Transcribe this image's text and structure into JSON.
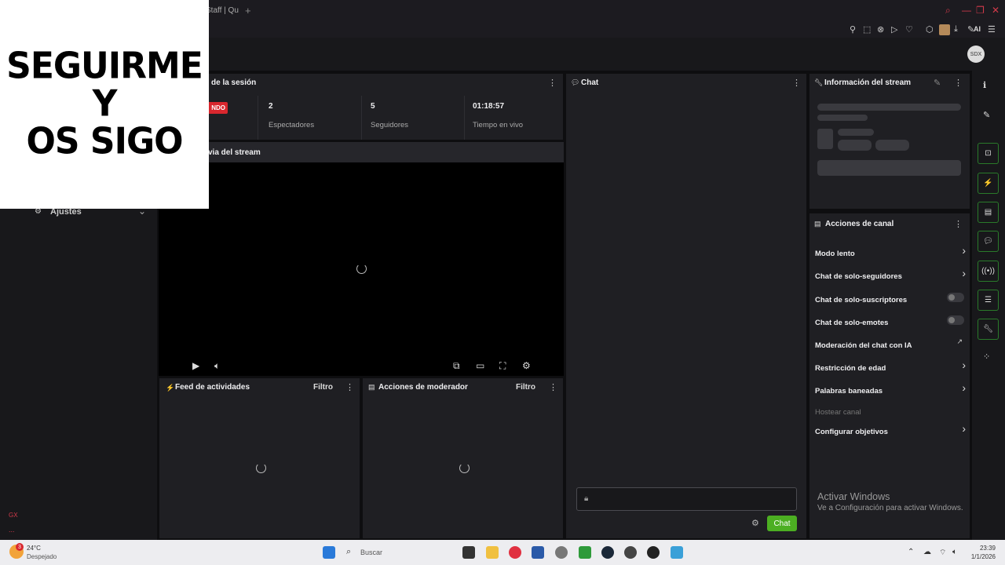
{
  "browser": {
    "tab_title": "Staff | Qu",
    "new_tab": "+",
    "toolbar_ai": "AI"
  },
  "header": {
    "avatar_text": "SDX"
  },
  "overlay": {
    "line1": "SEGUIRME",
    "line2": "Y",
    "line3": "OS SIGO"
  },
  "left_nav": {
    "settings_label": "Ajustes",
    "gx_label": "GX",
    "dots": "..."
  },
  "session": {
    "title": "ón de la sesión",
    "live_badge": "NDO",
    "stats": [
      {
        "value": "2",
        "label": "Espectadores"
      },
      {
        "value": "5",
        "label": "Seguidores"
      },
      {
        "value": "01:18:57",
        "label": "Tiempo en vivo"
      }
    ]
  },
  "preview": {
    "title": "via del stream"
  },
  "feed": {
    "title": "Feed de actividades",
    "filter": "Filtro"
  },
  "moderator": {
    "title": "Acciones de moderador",
    "filter": "Filtro"
  },
  "chat": {
    "title": "Chat",
    "send_label": "Chat"
  },
  "stream_info": {
    "title": "Información del stream"
  },
  "channel_actions": {
    "title": "Acciones de canal",
    "items": [
      {
        "label": "Modo lento",
        "control": "chevron"
      },
      {
        "label": "Chat de solo-seguidores",
        "control": "chevron"
      },
      {
        "label": "Chat de solo-suscriptores",
        "control": "toggle"
      },
      {
        "label": "Chat de solo-emotes",
        "control": "toggle"
      },
      {
        "label": "Moderación del chat con IA",
        "control": "external"
      },
      {
        "label": "Restricción de edad",
        "control": "chevron"
      },
      {
        "label": "Palabras baneadas",
        "control": "chevron"
      },
      {
        "label": "Hostear canal",
        "control": "none"
      },
      {
        "label": "Configurar objetivos",
        "control": "chevron"
      }
    ]
  },
  "activate_windows": {
    "title": "Activar Windows",
    "subtitle": "Ve a Configuración para activar Windows."
  },
  "taskbar": {
    "weather_badge": "3",
    "temperature": "24°C",
    "condition": "Despejado",
    "search_placeholder": "Buscar",
    "time": "23:39",
    "date": "1/1/2026"
  }
}
